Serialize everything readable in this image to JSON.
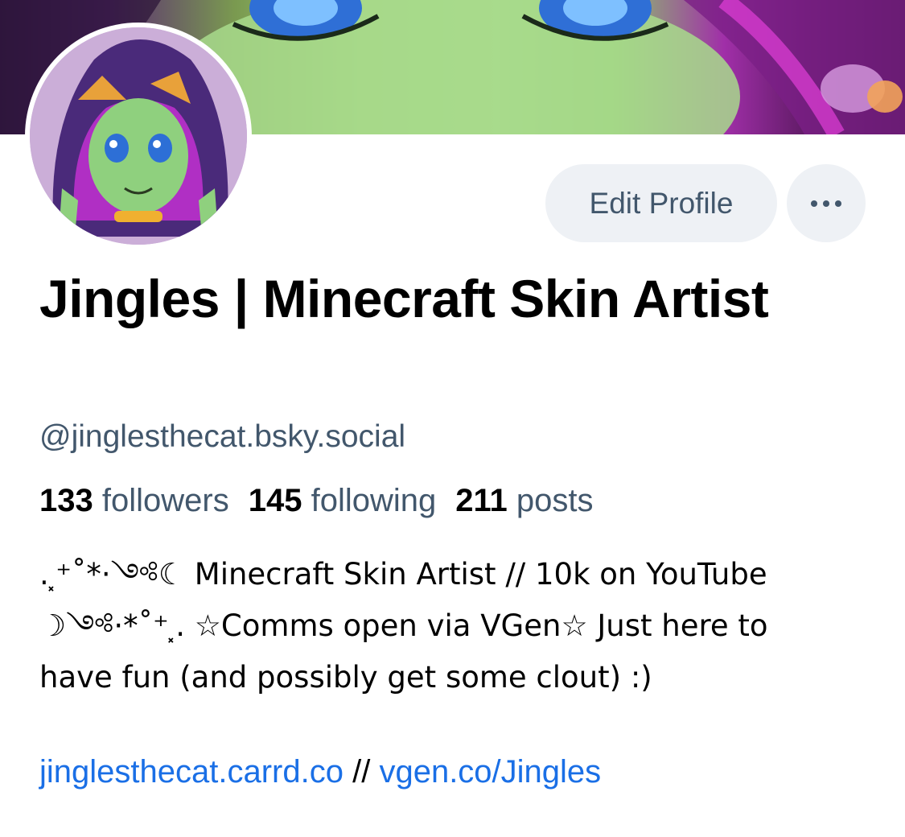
{
  "profile": {
    "display_name": "Jingles | Minecraft Skin Artist",
    "handle": "@jinglesthecat.bsky.social",
    "edit_profile_label": "Edit Profile",
    "more_label": "…",
    "stats": {
      "followers_count": "133",
      "followers_label": "followers",
      "following_count": "145",
      "following_label": "following",
      "posts_count": "211",
      "posts_label": "posts"
    },
    "bio": ".⸼⁺˚*·༺☾ Minecraft Skin Artist // 10k on YouTube\n☽༺·*˚⁺⸼. ☆Comms open via VGen☆ Just here to\nhave fun (and possibly get some clout) :)",
    "links": {
      "link1": "jinglesthecat.carrd.co",
      "separator": "//",
      "link2": "vgen.co/Jingles"
    }
  },
  "colors": {
    "text_primary": "#000000",
    "text_secondary": "#42576c",
    "link": "#1a6fe6",
    "button_bg": "#eef1f5"
  },
  "icons": {
    "more": "more-horizontal-icon"
  }
}
